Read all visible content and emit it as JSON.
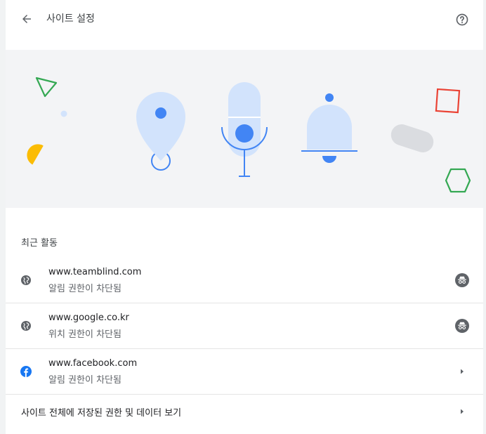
{
  "header": {
    "title": "사이트 설정",
    "back_icon": "arrow-back-icon",
    "help_icon": "help-icon"
  },
  "banner": {
    "illustrations": [
      "location-pin-icon",
      "microphone-icon",
      "notification-bell-icon"
    ],
    "accent_color": "#4285f4",
    "light_color": "#d2e3fc"
  },
  "recent": {
    "heading": "최근 활동",
    "items": [
      {
        "site": "www.teamblind.com",
        "status": "알림 권한이 차단됨",
        "site_icon": "globe-icon",
        "action_icon": "incognito-icon"
      },
      {
        "site": "www.google.co.kr",
        "status": "위치 권한이 차단됨",
        "site_icon": "globe-icon",
        "action_icon": "incognito-icon"
      },
      {
        "site": "www.facebook.com",
        "status": "알림 권한이 차단됨",
        "site_icon": "facebook-icon",
        "action_icon": "chevron-right-icon"
      }
    ]
  },
  "all_sites": {
    "label": "사이트 전체에 저장된 권한 및 데이터 보기",
    "icon": "chevron-right-icon"
  }
}
